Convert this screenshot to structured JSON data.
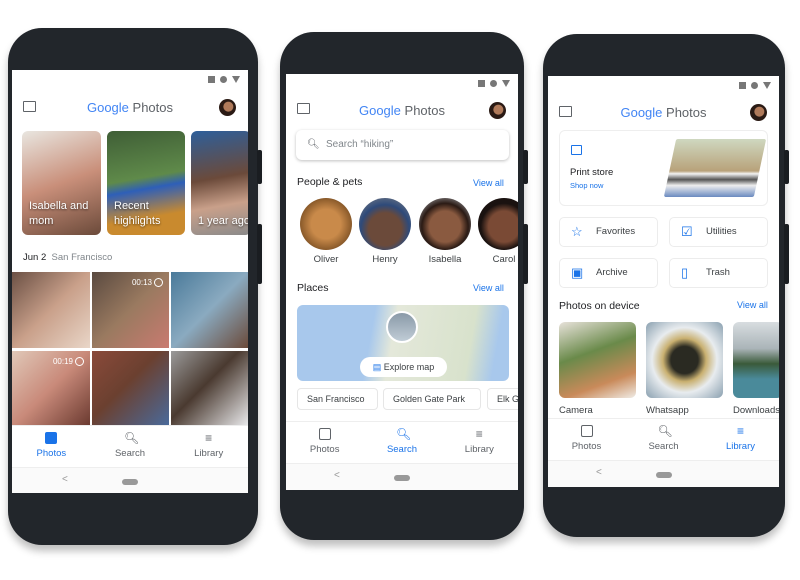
{
  "app": {
    "title_google": "Google",
    "title_photos": " Photos"
  },
  "brand": {
    "accent": "#1a73e8",
    "g_blue": "#4285f4",
    "g_red": "#ea4335",
    "g_yellow": "#fbbc05",
    "g_green": "#34a853"
  },
  "nav": {
    "photos": "Photos",
    "search": "Search",
    "library": "Library"
  },
  "photos_screen": {
    "memories": [
      "Isabella and mom",
      "Recent highlights",
      "1 year ago"
    ],
    "date": "Jun 2",
    "location": "San Francisco",
    "videos": [
      "00:13",
      "00:19"
    ]
  },
  "search_screen": {
    "search_placeholder": "Search “hiking”",
    "people_title": "People & pets",
    "view_all": "View all",
    "people": [
      "Oliver",
      "Henry",
      "Isabella",
      "Carol"
    ],
    "places_title": "Places",
    "explore_map": "Explore map",
    "places": [
      "San Francisco",
      "Golden Gate Park",
      "Elk G"
    ]
  },
  "library_screen": {
    "print_store": "Print store",
    "shop_now": "Shop now",
    "tiles": [
      "Favorites",
      "Utilities",
      "Archive",
      "Trash"
    ],
    "device_title": "Photos on device",
    "view_all": "View all",
    "folders": [
      "Camera",
      "Whatsapp",
      "Downloads"
    ]
  }
}
